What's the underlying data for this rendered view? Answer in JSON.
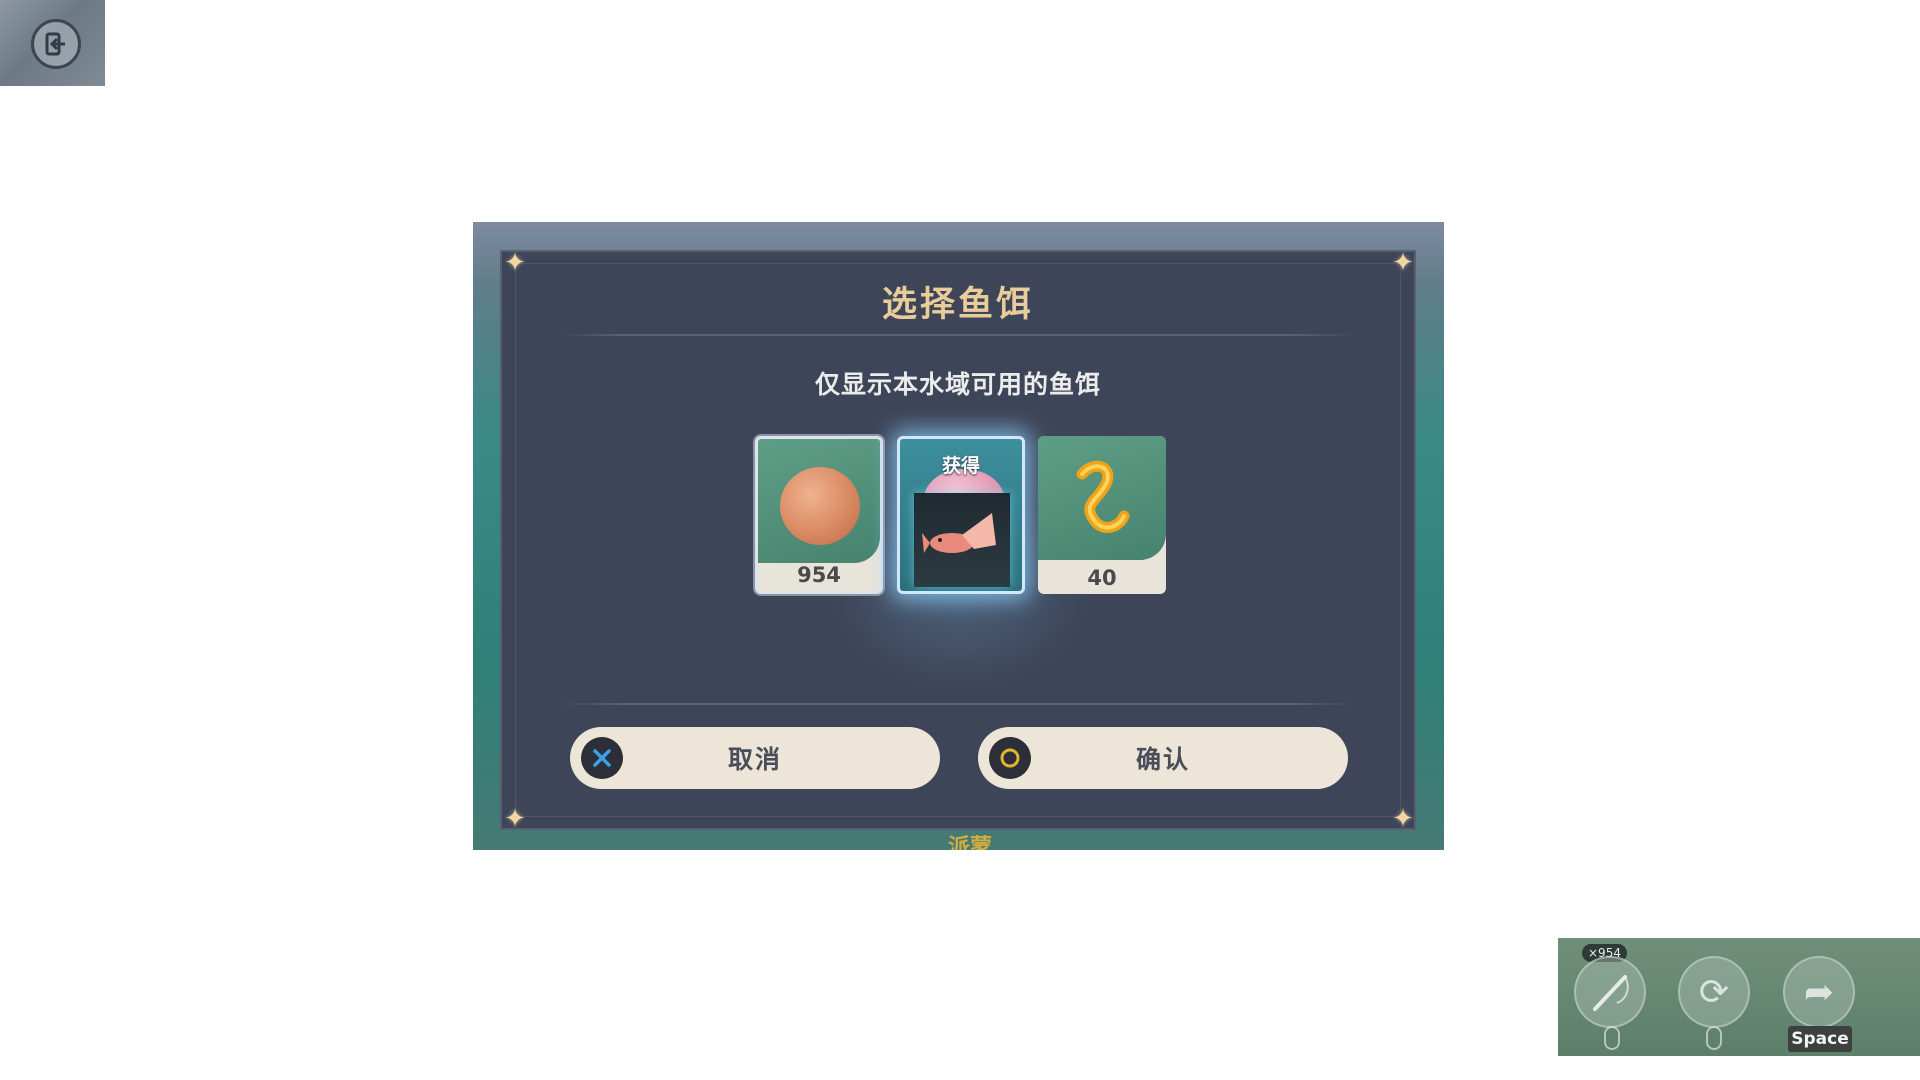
{
  "dialog": {
    "title": "选择鱼饵",
    "subtitle": "仅显示本水域可用的鱼饵",
    "baits": [
      {
        "name": "bait-fruit-paste",
        "count": "954",
        "selected": true
      },
      {
        "name": "bait-obtained",
        "label": "获得",
        "active": true
      },
      {
        "name": "bait-worm",
        "count": "40"
      }
    ],
    "cancel_label": "取消",
    "confirm_label": "确认",
    "hint_text": "派蒙"
  },
  "hud": {
    "bait_count": "×954",
    "space_key": "Space"
  },
  "colors": {
    "panel": "#3e4558",
    "title": "#e8cc99",
    "button_bg": "#ece5d8",
    "cancel_icon": "#3aa0e8",
    "confirm_icon": "#e3b528"
  },
  "icons": [
    "exit-icon",
    "cancel-cross-icon",
    "confirm-circle-icon",
    "fishing-rod-icon",
    "reel-icon",
    "jump-icon"
  ]
}
